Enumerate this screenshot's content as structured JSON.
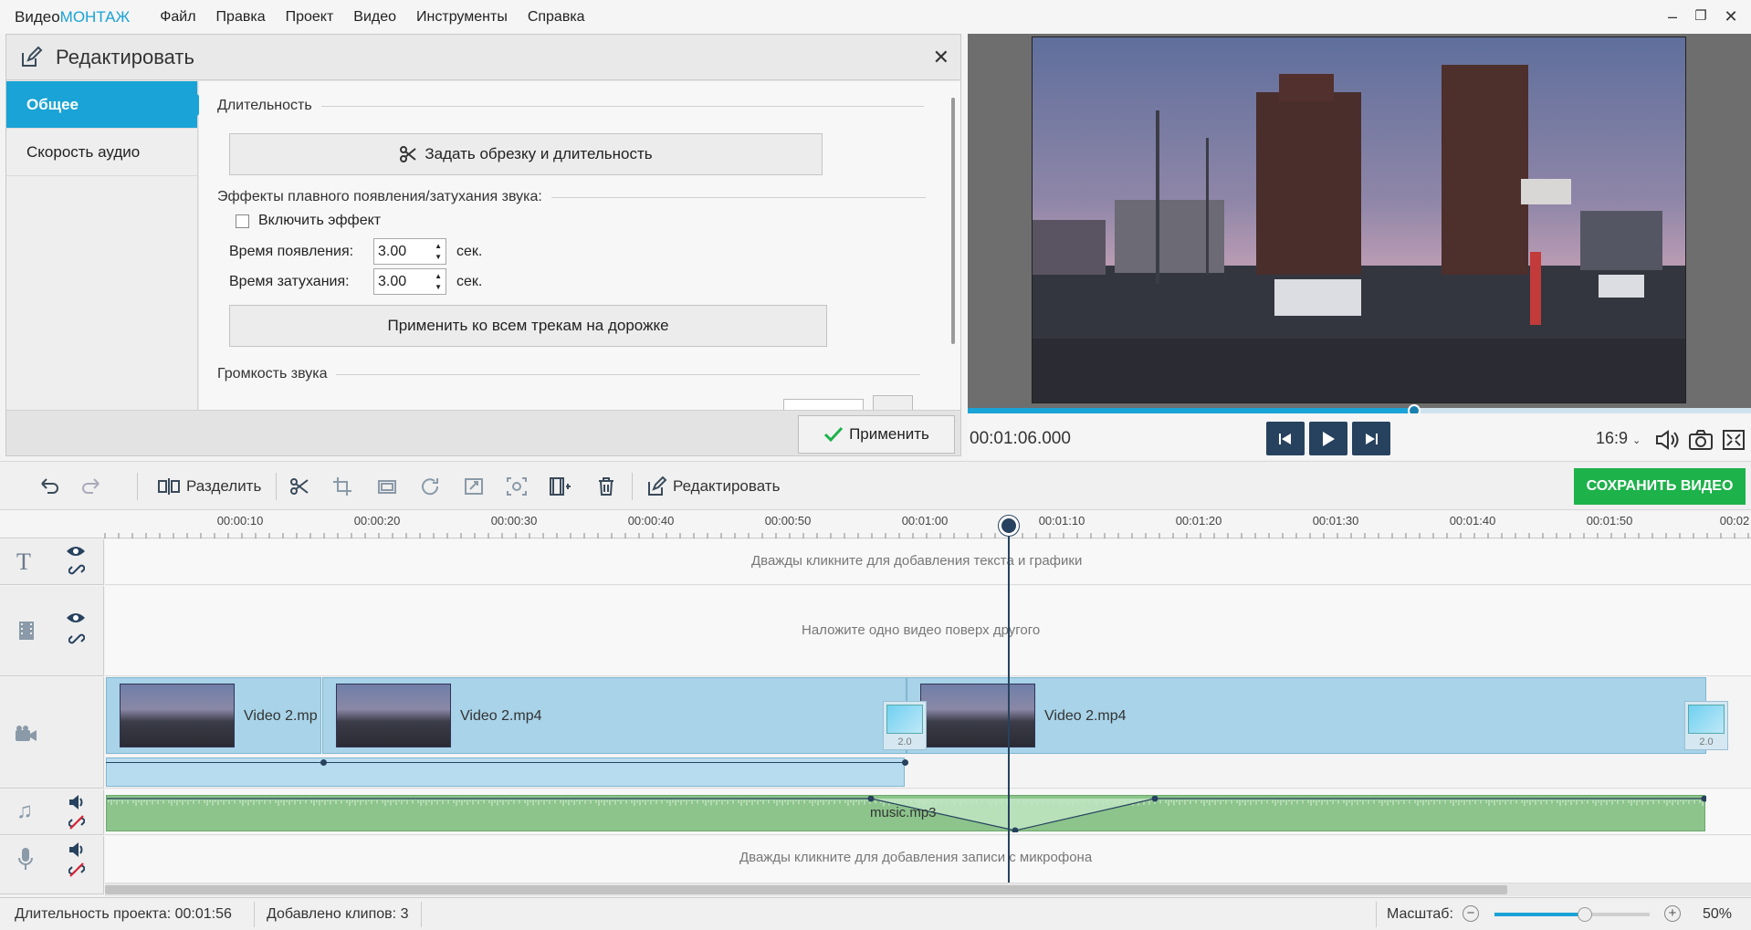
{
  "app": {
    "logo_prefix": "Видео",
    "logo_brand": "МОНТАЖ"
  },
  "menu": [
    "Файл",
    "Правка",
    "Проект",
    "Видео",
    "Инструменты",
    "Справка"
  ],
  "window_controls": {
    "minimize": "–",
    "restore": "❐",
    "close": "✕"
  },
  "edit_panel": {
    "title": "Редактировать",
    "close": "✕",
    "nav": [
      {
        "label": "Общее",
        "active": true
      },
      {
        "label": "Скорость аудио",
        "active": false
      }
    ],
    "section_duration": "Длительность",
    "trim_button": "Задать обрезку и длительность",
    "section_fade": "Эффекты плавного появления/затухания звука:",
    "enable_effect": "Включить эффект",
    "fade_in_label": "Время появления:",
    "fade_in_value": "3.00",
    "fade_out_label": "Время затухания:",
    "fade_out_value": "3.00",
    "unit": "сек.",
    "apply_all_button": "Применить ко всем трекам на дорожке",
    "section_volume": "Громкость звука",
    "apply_button": "Применить"
  },
  "preview": {
    "timecode": "00:01:06.000",
    "progress": 0.57,
    "aspect": "16:9"
  },
  "toolbar": {
    "split": "Разделить",
    "edit": "Редактировать",
    "save_video": "СОХРАНИТЬ ВИДЕО"
  },
  "ruler": [
    "00:00:10",
    "00:00:20",
    "00:00:30",
    "00:00:40",
    "00:00:50",
    "00:01:00",
    "00:01:10",
    "00:01:20",
    "00:01:30",
    "00:01:40",
    "00:01:50",
    "00:02"
  ],
  "tracks": {
    "text_hint": "Дважды кликните для добавления текста и графики",
    "overlay_hint": "Наложите одно видео поверх другого",
    "clips": [
      "Video 2.mp",
      "Video 2.mp4",
      "Video 2.mp4"
    ],
    "transition_duration": "2.0",
    "music_label": "music.mp3",
    "mic_hint": "Дважды кликните для добавления записи с микрофона"
  },
  "status": {
    "duration": "Длительность проекта:  00:01:56",
    "clips_added": "Добавлено клипов: 3",
    "scale_label": "Масштаб:",
    "scale_value": "50%",
    "scale_fraction": 0.58
  },
  "colors": {
    "accent": "#1aa3d6",
    "save": "#1db24a",
    "dark": "#27425e"
  }
}
